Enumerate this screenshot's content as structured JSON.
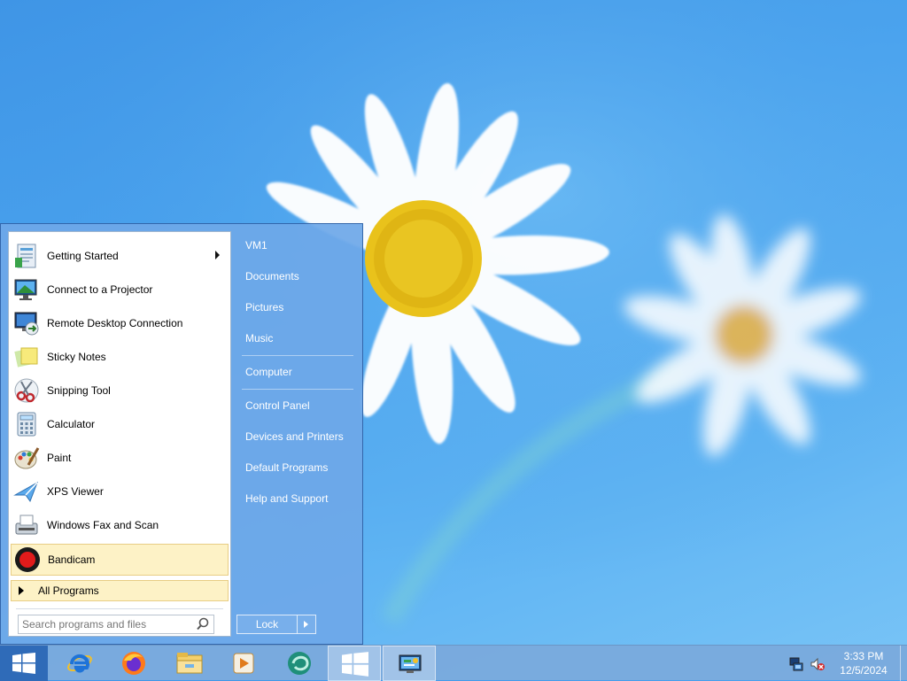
{
  "start_menu": {
    "programs": [
      {
        "label": "Getting Started",
        "icon": "getting-started-icon",
        "submenu": true
      },
      {
        "label": "Connect to a Projector",
        "icon": "projector-icon"
      },
      {
        "label": "Remote Desktop Connection",
        "icon": "remote-desktop-icon"
      },
      {
        "label": "Sticky Notes",
        "icon": "sticky-notes-icon"
      },
      {
        "label": "Snipping Tool",
        "icon": "snipping-tool-icon"
      },
      {
        "label": "Calculator",
        "icon": "calculator-icon"
      },
      {
        "label": "Paint",
        "icon": "paint-icon"
      },
      {
        "label": "XPS Viewer",
        "icon": "xps-viewer-icon"
      },
      {
        "label": "Windows Fax and Scan",
        "icon": "fax-scan-icon"
      },
      {
        "label": "Bandicam",
        "icon": "bandicam-icon",
        "highlighted": true
      }
    ],
    "all_programs_label": "All Programs",
    "search_placeholder": "Search programs and files",
    "places": [
      "VM1",
      "Documents",
      "Pictures",
      "Music",
      "Computer",
      "Control Panel",
      "Devices and Printers",
      "Default Programs",
      "Help and Support"
    ],
    "lock_label": "Lock"
  },
  "taskbar": {
    "pinned": [
      "internet-explorer-icon",
      "firefox-icon",
      "file-explorer-icon",
      "media-player-icon",
      "browser-app-icon",
      "start-menu-app-icon",
      "control-panel-icon"
    ],
    "tray": [
      "network-icon",
      "volume-muted-icon"
    ],
    "clock_time": "3:33 PM",
    "clock_date": "12/5/2024"
  },
  "colors": {
    "menu_blue": "#6ea8e8",
    "start_button": "#2f6bb8",
    "highlight": "#fdf2c6"
  }
}
